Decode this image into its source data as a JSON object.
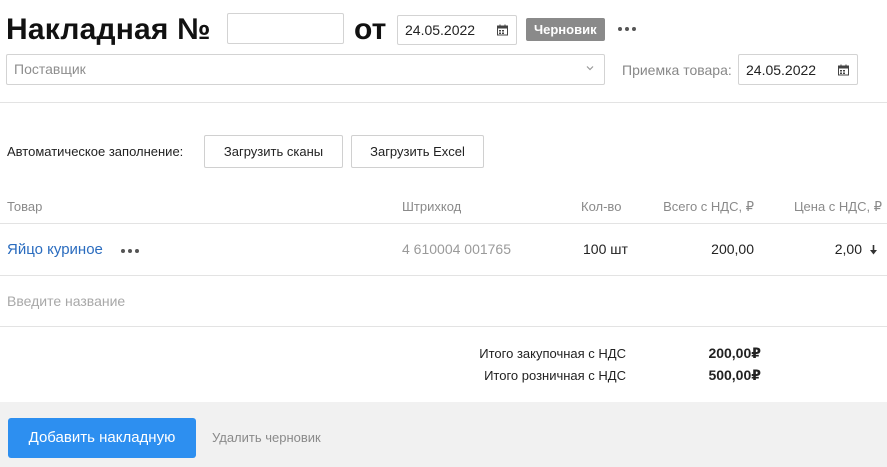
{
  "header": {
    "title": "Накладная №",
    "number_value": "",
    "from_label": "от",
    "date": "24.05.2022",
    "status_badge": "Черновик"
  },
  "supplier": {
    "placeholder": "Поставщик"
  },
  "receipt": {
    "label": "Приемка товара:",
    "date": "24.05.2022"
  },
  "autofill": {
    "label": "Автоматическое заполнение:",
    "buttons": [
      "Загрузить сканы",
      "Загрузить Excel"
    ]
  },
  "table": {
    "columns": [
      "Товар",
      "Штрихкод",
      "Кол-во",
      "Всего с НДС, ₽",
      "Цена с НДС, ₽"
    ],
    "rows": [
      {
        "name": "Яйцо куриное",
        "barcode": "4 610004 001765",
        "qty": "100 шт",
        "total": "200,00",
        "price": "2,00"
      }
    ],
    "new_item_placeholder": "Введите название"
  },
  "totals": {
    "purchase_label": "Итого закупочная с НДС",
    "purchase_value": "200,00₽",
    "retail_label": "Итого розничная с НДС",
    "retail_value": "500,00₽"
  },
  "footer": {
    "add_button": "Добавить накладную",
    "delete_link": "Удалить черновик"
  },
  "colors": {
    "accent": "#2d8ff0",
    "link": "#2a6cbf",
    "badge": "#8a8a8a"
  }
}
